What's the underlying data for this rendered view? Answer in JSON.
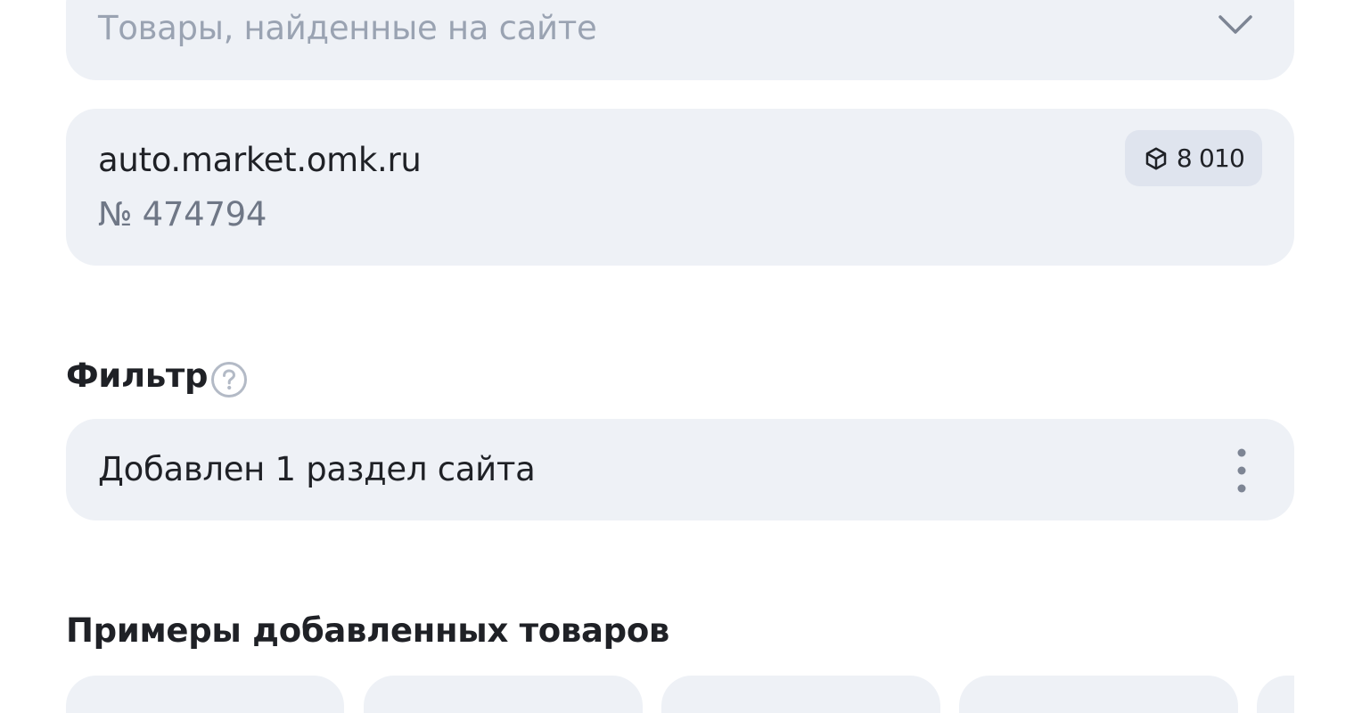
{
  "source_select": {
    "placeholder": "Товары, найденные на сайте",
    "icon": "chevron-down-icon"
  },
  "feed": {
    "domain": "auto.market.omk.ru",
    "number": "№ 474794",
    "items_count": "8 010",
    "icon": "cube-icon"
  },
  "filter": {
    "title": "Фильтр",
    "help_icon": "question-circle-icon",
    "value": "Добавлен 1 раздел сайта",
    "menu_icon": "more-vertical-icon"
  },
  "examples": {
    "title": "Примеры добавленных товаров",
    "cards_visible": 5
  },
  "colors": {
    "surface": "#eef1f6",
    "badge": "#dfe4ee",
    "text": "#1f2126",
    "muted": "#6f7786",
    "placeholder": "#9aa3b2"
  }
}
